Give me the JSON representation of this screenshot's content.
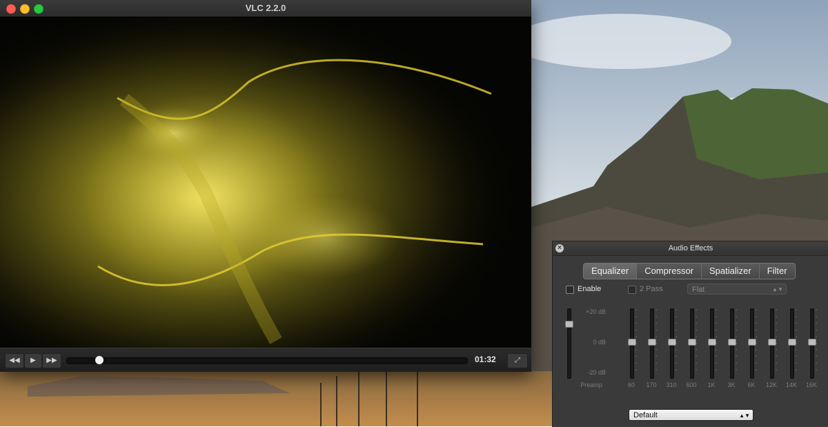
{
  "vlc": {
    "title": "VLC 2.2.0",
    "controls": {
      "rewind_glyph": "◀◀",
      "play_glyph": "▶",
      "forward_glyph": "▶▶",
      "fullscreen_glyph": "⤢",
      "time": "01:32",
      "seek_fraction": 0.06
    }
  },
  "audio_effects": {
    "title": "Audio Effects",
    "tabs": [
      {
        "label": "Equalizer",
        "active": true
      },
      {
        "label": "Compressor",
        "active": false
      },
      {
        "label": "Spatializer",
        "active": false
      },
      {
        "label": "Filter",
        "active": false
      }
    ],
    "enable_label": "Enable",
    "two_pass_label": "2 Pass",
    "preset_value": "Flat",
    "db_labels": [
      "+20 dB",
      "0 dB",
      "-20 dB"
    ],
    "preamp_label": "Preamp",
    "bands": [
      "60",
      "170",
      "310",
      "600",
      "1K",
      "3K",
      "6K",
      "12K",
      "14K",
      "16K"
    ],
    "profile_value": "Default"
  },
  "colors": {
    "accent_yellow": "#d9c52a",
    "panel_bg": "#3a3a3a",
    "traffic_close": "#fc5f57",
    "traffic_min": "#fdbc2e",
    "traffic_max": "#28c840"
  }
}
